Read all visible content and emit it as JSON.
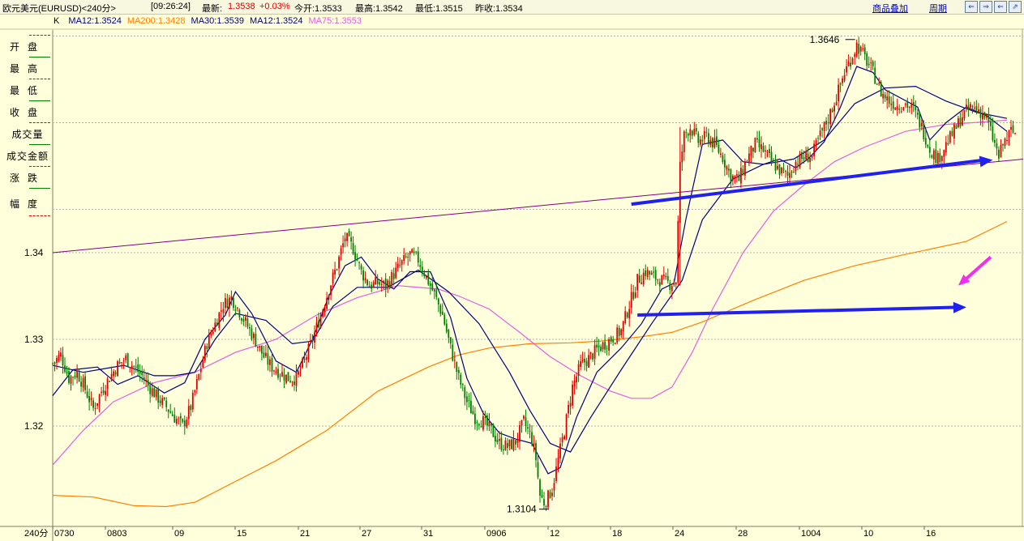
{
  "header": {
    "instrument": "欧元美元(EURUSD)<240分>",
    "time": "[09:26:24]",
    "latest_label": "最新:",
    "latest_value": "1.3538",
    "change": "+0.03%",
    "open_label": "今开:1.3533",
    "high_label": "最高:1.3542",
    "low_label": "最低:1.3515",
    "prev_close_label": "昨收:1.3534",
    "overlay_link": "商品叠加",
    "period_link": "周期",
    "window_buttons": [
      "⇐",
      "⇒",
      "⇐",
      "⇗"
    ]
  },
  "legend": {
    "prefix": "K",
    "items": [
      {
        "text": "MA12:1.3524",
        "color": "#000080"
      },
      {
        "text": "MA200:1.3428",
        "color": "#ff8000"
      },
      {
        "text": "MA30:1.3539",
        "color": "#000080"
      },
      {
        "text": "MA12:1.3524",
        "color": "#000080"
      },
      {
        "text": "MA75:1.3553",
        "color": "#e060e0"
      }
    ]
  },
  "side_panel": [
    "开盘",
    "最高",
    "最低",
    "收盘",
    "成交量",
    "成交金额",
    "涨跌",
    "幅度"
  ],
  "chart_data": {
    "type": "candlestick",
    "period_label": "240分",
    "x_tick_labels": [
      "0730",
      "0803",
      "09",
      "15",
      "21",
      "27",
      "31",
      "0906",
      "12",
      "18",
      "24",
      "28",
      "1004",
      "10",
      "16"
    ],
    "ylim": [
      1.3075,
      1.3715
    ],
    "y_ticks": [
      1.32,
      1.33,
      1.34
    ],
    "grid": true,
    "annotations": [
      {
        "text": "1.3646",
        "value": 1.3646,
        "kind": "high"
      },
      {
        "text": "1.3104",
        "value": 1.3104,
        "kind": "low"
      }
    ],
    "price_path": [
      [
        0,
        1.3272
      ],
      [
        4,
        1.3282
      ],
      [
        8,
        1.3255
      ],
      [
        12,
        1.3262
      ],
      [
        15,
        1.3248
      ],
      [
        20,
        1.322
      ],
      [
        24,
        1.324
      ],
      [
        28,
        1.3256
      ],
      [
        32,
        1.327
      ],
      [
        36,
        1.3278
      ],
      [
        40,
        1.3268
      ],
      [
        44,
        1.3258
      ],
      [
        48,
        1.3244
      ],
      [
        52,
        1.3232
      ],
      [
        56,
        1.3222
      ],
      [
        60,
        1.321
      ],
      [
        64,
        1.32
      ],
      [
        68,
        1.3222
      ],
      [
        72,
        1.3258
      ],
      [
        76,
        1.3296
      ],
      [
        80,
        1.3318
      ],
      [
        84,
        1.334
      ],
      [
        88,
        1.3348
      ],
      [
        92,
        1.3332
      ],
      [
        96,
        1.3315
      ],
      [
        100,
        1.3298
      ],
      [
        104,
        1.328
      ],
      [
        108,
        1.3268
      ],
      [
        112,
        1.3262
      ],
      [
        116,
        1.3255
      ],
      [
        120,
        1.3255
      ],
      [
        124,
        1.3275
      ],
      [
        128,
        1.33
      ],
      [
        132,
        1.3328
      ],
      [
        136,
        1.3358
      ],
      [
        140,
        1.3385
      ],
      [
        144,
        1.3418
      ],
      [
        148,
        1.3405
      ],
      [
        152,
        1.3378
      ],
      [
        156,
        1.3362
      ],
      [
        160,
        1.3365
      ],
      [
        164,
        1.3362
      ],
      [
        168,
        1.3375
      ],
      [
        172,
        1.3388
      ],
      [
        176,
        1.3398
      ],
      [
        180,
        1.3392
      ],
      [
        184,
        1.3372
      ],
      [
        188,
        1.3352
      ],
      [
        192,
        1.3328
      ],
      [
        196,
        1.329
      ],
      [
        200,
        1.3255
      ],
      [
        204,
        1.3228
      ],
      [
        208,
        1.321
      ],
      [
        212,
        1.3205
      ],
      [
        216,
        1.3195
      ],
      [
        220,
        1.318
      ],
      [
        224,
        1.3176
      ],
      [
        228,
        1.3182
      ],
      [
        232,
        1.3205
      ],
      [
        236,
        1.3185
      ],
      [
        238,
        1.3162
      ],
      [
        240,
        1.312
      ],
      [
        242,
        1.3112
      ],
      [
        244,
        1.3118
      ],
      [
        246,
        1.3128
      ],
      [
        248,
        1.315
      ],
      [
        252,
        1.3195
      ],
      [
        256,
        1.3245
      ],
      [
        260,
        1.327
      ],
      [
        264,
        1.3278
      ],
      [
        268,
        1.3288
      ],
      [
        272,
        1.3295
      ],
      [
        276,
        1.3302
      ],
      [
        280,
        1.331
      ],
      [
        284,
        1.334
      ],
      [
        288,
        1.3368
      ],
      [
        292,
        1.3378
      ],
      [
        296,
        1.3372
      ],
      [
        300,
        1.3368
      ],
      [
        304,
        1.3364
      ],
      [
        307,
        1.3368
      ],
      [
        309,
        1.35
      ],
      [
        311,
        1.3535
      ],
      [
        314,
        1.3545
      ],
      [
        318,
        1.3528
      ],
      [
        322,
        1.3534
      ],
      [
        326,
        1.3525
      ],
      [
        330,
        1.351
      ],
      [
        334,
        1.3488
      ],
      [
        338,
        1.3484
      ],
      [
        342,
        1.3508
      ],
      [
        346,
        1.3525
      ],
      [
        350,
        1.3518
      ],
      [
        354,
        1.3505
      ],
      [
        358,
        1.3495
      ],
      [
        362,
        1.3488
      ],
      [
        366,
        1.3505
      ],
      [
        370,
        1.351
      ],
      [
        374,
        1.3512
      ],
      [
        378,
        1.3535
      ],
      [
        382,
        1.3555
      ],
      [
        386,
        1.358
      ],
      [
        390,
        1.3608
      ],
      [
        394,
        1.3628
      ],
      [
        396,
        1.364
      ],
      [
        400,
        1.3625
      ],
      [
        404,
        1.3608
      ],
      [
        408,
        1.3585
      ],
      [
        412,
        1.3575
      ],
      [
        416,
        1.357
      ],
      [
        420,
        1.3572
      ],
      [
        424,
        1.3565
      ],
      [
        428,
        1.3545
      ],
      [
        432,
        1.352
      ],
      [
        436,
        1.3508
      ],
      [
        440,
        1.3525
      ],
      [
        444,
        1.354
      ],
      [
        448,
        1.3558
      ],
      [
        452,
        1.3568
      ],
      [
        456,
        1.3565
      ],
      [
        460,
        1.3555
      ],
      [
        464,
        1.3525
      ],
      [
        466,
        1.351
      ],
      [
        468,
        1.3525
      ],
      [
        472,
        1.354
      ],
      [
        474,
        1.3538
      ]
    ],
    "moving_averages": [
      {
        "name": "MA200",
        "color": "#ff8000",
        "points": [
          [
            0,
            1.312
          ],
          [
            20,
            1.3118
          ],
          [
            40,
            1.3108
          ],
          [
            56,
            1.3107
          ],
          [
            70,
            1.3112
          ],
          [
            85,
            1.313
          ],
          [
            110,
            1.316
          ],
          [
            135,
            1.3195
          ],
          [
            160,
            1.324
          ],
          [
            185,
            1.3268
          ],
          [
            200,
            1.3282
          ],
          [
            215,
            1.329
          ],
          [
            235,
            1.3295
          ],
          [
            255,
            1.3296
          ],
          [
            270,
            1.3298
          ],
          [
            290,
            1.3303
          ],
          [
            305,
            1.3308
          ],
          [
            320,
            1.332
          ],
          [
            345,
            1.3345
          ],
          [
            370,
            1.3368
          ],
          [
            395,
            1.3385
          ],
          [
            420,
            1.3398
          ],
          [
            450,
            1.3413
          ],
          [
            470,
            1.3436
          ]
        ]
      },
      {
        "name": "MA75",
        "color": "#e060e0",
        "points": [
          [
            0,
            1.3155
          ],
          [
            15,
            1.3195
          ],
          [
            30,
            1.3228
          ],
          [
            50,
            1.325
          ],
          [
            70,
            1.3262
          ],
          [
            90,
            1.3285
          ],
          [
            110,
            1.33
          ],
          [
            130,
            1.3328
          ],
          [
            150,
            1.3348
          ],
          [
            170,
            1.3362
          ],
          [
            190,
            1.3358
          ],
          [
            200,
            1.335
          ],
          [
            215,
            1.3335
          ],
          [
            230,
            1.3308
          ],
          [
            245,
            1.328
          ],
          [
            260,
            1.3258
          ],
          [
            275,
            1.324
          ],
          [
            285,
            1.3232
          ],
          [
            295,
            1.3232
          ],
          [
            305,
            1.3245
          ],
          [
            315,
            1.3285
          ],
          [
            325,
            1.3335
          ],
          [
            340,
            1.34
          ],
          [
            355,
            1.3448
          ],
          [
            370,
            1.3478
          ],
          [
            385,
            1.3505
          ],
          [
            400,
            1.3522
          ],
          [
            420,
            1.354
          ],
          [
            440,
            1.3548
          ],
          [
            460,
            1.3551
          ],
          [
            470,
            1.3553
          ]
        ]
      },
      {
        "name": "MA30",
        "color": "#000080",
        "points": [
          [
            0,
            1.327
          ],
          [
            15,
            1.3262
          ],
          [
            35,
            1.327
          ],
          [
            50,
            1.3258
          ],
          [
            60,
            1.3258
          ],
          [
            70,
            1.3262
          ],
          [
            80,
            1.33
          ],
          [
            90,
            1.333
          ],
          [
            105,
            1.3322
          ],
          [
            118,
            1.3295
          ],
          [
            128,
            1.3298
          ],
          [
            138,
            1.3338
          ],
          [
            150,
            1.336
          ],
          [
            165,
            1.336
          ],
          [
            180,
            1.338
          ],
          [
            195,
            1.3355
          ],
          [
            210,
            1.3318
          ],
          [
            225,
            1.3262
          ],
          [
            235,
            1.3218
          ],
          [
            245,
            1.318
          ],
          [
            255,
            1.317
          ],
          [
            265,
            1.321
          ],
          [
            280,
            1.3265
          ],
          [
            295,
            1.3318
          ],
          [
            310,
            1.3368
          ],
          [
            320,
            1.3438
          ],
          [
            335,
            1.3485
          ],
          [
            350,
            1.3502
          ],
          [
            365,
            1.3508
          ],
          [
            380,
            1.353
          ],
          [
            395,
            1.3572
          ],
          [
            410,
            1.359
          ],
          [
            425,
            1.3592
          ],
          [
            440,
            1.3575
          ],
          [
            455,
            1.3562
          ],
          [
            470,
            1.3555
          ]
        ]
      },
      {
        "name": "MA12",
        "color": "#000080",
        "points": [
          [
            0,
            1.3235
          ],
          [
            10,
            1.3265
          ],
          [
            22,
            1.3268
          ],
          [
            32,
            1.3248
          ],
          [
            42,
            1.3258
          ],
          [
            55,
            1.3238
          ],
          [
            65,
            1.325
          ],
          [
            75,
            1.33
          ],
          [
            85,
            1.3328
          ],
          [
            90,
            1.3355
          ],
          [
            98,
            1.333
          ],
          [
            110,
            1.3275
          ],
          [
            120,
            1.3262
          ],
          [
            128,
            1.33
          ],
          [
            136,
            1.335
          ],
          [
            144,
            1.3385
          ],
          [
            152,
            1.3395
          ],
          [
            160,
            1.337
          ],
          [
            168,
            1.3358
          ],
          [
            176,
            1.3378
          ],
          [
            186,
            1.3378
          ],
          [
            196,
            1.3325
          ],
          [
            204,
            1.3255
          ],
          [
            212,
            1.3215
          ],
          [
            220,
            1.3192
          ],
          [
            228,
            1.3185
          ],
          [
            236,
            1.318
          ],
          [
            244,
            1.3145
          ],
          [
            250,
            1.3152
          ],
          [
            258,
            1.321
          ],
          [
            268,
            1.3262
          ],
          [
            280,
            1.329
          ],
          [
            290,
            1.3318
          ],
          [
            300,
            1.3358
          ],
          [
            306,
            1.3365
          ],
          [
            312,
            1.344
          ],
          [
            320,
            1.3525
          ],
          [
            330,
            1.353
          ],
          [
            340,
            1.3505
          ],
          [
            350,
            1.3502
          ],
          [
            358,
            1.3508
          ],
          [
            366,
            1.3498
          ],
          [
            372,
            1.3508
          ],
          [
            380,
            1.3528
          ],
          [
            388,
            1.3568
          ],
          [
            396,
            1.3615
          ],
          [
            404,
            1.3608
          ],
          [
            410,
            1.3588
          ],
          [
            418,
            1.3578
          ],
          [
            426,
            1.3568
          ],
          [
            432,
            1.353
          ],
          [
            440,
            1.355
          ],
          [
            450,
            1.3568
          ],
          [
            460,
            1.3558
          ],
          [
            470,
            1.354
          ]
        ]
      }
    ],
    "trendlines": [
      {
        "name": "trendline-long",
        "color": "#800080",
        "from": [
          0,
          1.34
        ],
        "to": [
          478,
          1.3508
        ]
      },
      {
        "name": "trendline-support",
        "color": "#2020f0",
        "from": [
          285,
          1.3456
        ],
        "to": [
          463,
          1.3507
        ],
        "arrow": true
      },
      {
        "name": "trendline-horizontal",
        "color": "#2020f0",
        "from": [
          288,
          1.3328
        ],
        "to": [
          450,
          1.3337
        ],
        "arrow": true
      }
    ],
    "marker_arrow": {
      "color": "#f030f0",
      "from": [
        462,
        1.3395
      ],
      "to": [
        446,
        1.3362
      ]
    },
    "candle_count": 475
  }
}
